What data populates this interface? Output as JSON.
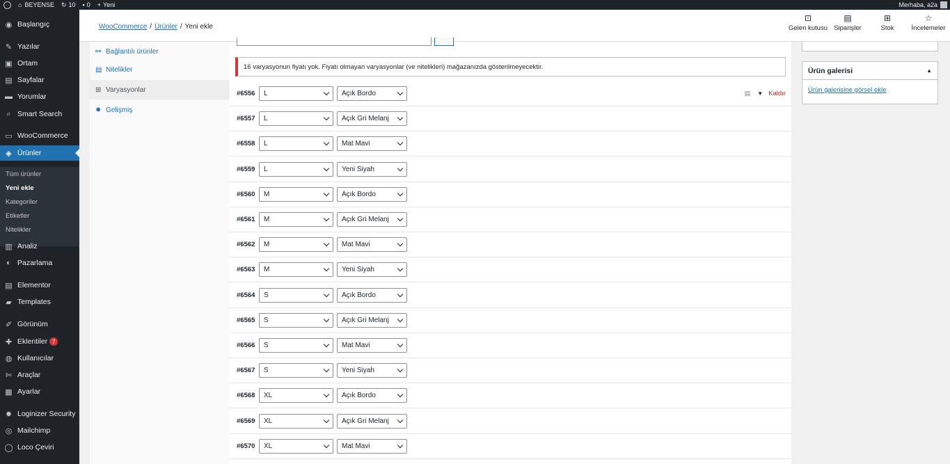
{
  "admin_bar": {
    "site_name": "BEYENSE",
    "updates": "10",
    "comments": "0",
    "new_label": "Yeni",
    "greeting": "Merhaba, a2a"
  },
  "sidebar": {
    "items": [
      {
        "label": "Başlangıç",
        "icon": "dashboard-icon",
        "glyph": "◉"
      },
      {
        "label": "Yazılar",
        "icon": "pin-icon",
        "glyph": "✎"
      },
      {
        "label": "Ortam",
        "icon": "media-icon",
        "glyph": "▣"
      },
      {
        "label": "Sayfalar",
        "icon": "pages-icon",
        "glyph": "▤"
      },
      {
        "label": "Yorumlar",
        "icon": "comments-icon",
        "glyph": "▬"
      },
      {
        "label": "Smart Search",
        "icon": "search-icon",
        "glyph": "⌕"
      },
      {
        "label": "WooCommerce",
        "icon": "woo-icon",
        "glyph": "▭"
      },
      {
        "label": "Ürünler",
        "icon": "products-icon",
        "glyph": "◈"
      },
      {
        "label": "Analiz",
        "icon": "analytics-icon",
        "glyph": "▥"
      },
      {
        "label": "Pazarlama",
        "icon": "marketing-icon",
        "glyph": "◐"
      },
      {
        "label": "Elementor",
        "icon": "elementor-icon",
        "glyph": "▤"
      },
      {
        "label": "Templates",
        "icon": "templates-icon",
        "glyph": "▰"
      },
      {
        "label": "Görünüm",
        "icon": "appearance-icon",
        "glyph": "✐"
      },
      {
        "label": "Eklentiler",
        "icon": "plugins-icon",
        "glyph": "✚",
        "badge": "7"
      },
      {
        "label": "Kullanıcılar",
        "icon": "users-icon",
        "glyph": "◍"
      },
      {
        "label": "Araçlar",
        "icon": "tools-icon",
        "glyph": "✄"
      },
      {
        "label": "Ayarlar",
        "icon": "settings-icon",
        "glyph": "▦"
      },
      {
        "label": "Loginizer Security",
        "icon": "gear-icon",
        "glyph": "✹"
      },
      {
        "label": "Mailchimp",
        "icon": "mailchimp-icon",
        "glyph": "◎"
      },
      {
        "label": "Loco Çeviri",
        "icon": "translate-icon",
        "glyph": "◯"
      }
    ],
    "submenu": [
      "Tüm ürünler",
      "Yeni ekle",
      "Kategoriler",
      "Etiketler",
      "Nitelikler"
    ]
  },
  "header": {
    "breadcrumb": [
      "WooCommerce",
      "Ürünler",
      "Yeni ekle"
    ],
    "buttons": [
      {
        "label": "Gelen kutusu",
        "icon": "inbox-icon",
        "glyph": "⊡"
      },
      {
        "label": "Siparişler",
        "icon": "orders-icon",
        "glyph": "▤"
      },
      {
        "label": "Stok",
        "icon": "stock-icon",
        "glyph": "⊞"
      },
      {
        "label": "İncelemeler",
        "icon": "star-icon",
        "glyph": "☆"
      }
    ]
  },
  "product_tabs": [
    {
      "label": "Bağlantılı ürünler",
      "icon": "link-icon",
      "glyph": "⚯"
    },
    {
      "label": "Nitelikler",
      "icon": "attributes-icon",
      "glyph": "▤"
    },
    {
      "label": "Varyasyonlar",
      "icon": "variations-icon",
      "glyph": "⊞"
    },
    {
      "label": "Gelişmiş",
      "icon": "advanced-gear-icon",
      "glyph": "✹"
    }
  ],
  "notice": "16 varyasyonun fiyatı yok. Fiyatı olmayan varyasyonlar (ve nitelikleri) mağazanızda gösterilmeyecektir.",
  "remove_label": "Kaldır",
  "variations": [
    {
      "id": "#6556",
      "size": "L",
      "color": "Açık Bordo"
    },
    {
      "id": "#6557",
      "size": "L",
      "color": "Açık Gri Melanj"
    },
    {
      "id": "#6558",
      "size": "L",
      "color": "Mat Mavi"
    },
    {
      "id": "#6559",
      "size": "L",
      "color": "Yeni Siyah"
    },
    {
      "id": "#6560",
      "size": "M",
      "color": "Açık Bordo"
    },
    {
      "id": "#6561",
      "size": "M",
      "color": "Açık Gri Melanj"
    },
    {
      "id": "#6562",
      "size": "M",
      "color": "Mat Mavi"
    },
    {
      "id": "#6563",
      "size": "M",
      "color": "Yeni Siyah"
    },
    {
      "id": "#6564",
      "size": "S",
      "color": "Açık Bordo"
    },
    {
      "id": "#6565",
      "size": "S",
      "color": "Açık Gri Melanj"
    },
    {
      "id": "#6566",
      "size": "S",
      "color": "Mat Mavi"
    },
    {
      "id": "#6567",
      "size": "S",
      "color": "Yeni Siyah"
    },
    {
      "id": "#6568",
      "size": "XL",
      "color": "Açık Bordo"
    },
    {
      "id": "#6569",
      "size": "XL",
      "color": "Açık Gri Melanj"
    },
    {
      "id": "#6570",
      "size": "XL",
      "color": "Mat Mavi"
    }
  ],
  "gallery": {
    "title": "Ürün galerisi",
    "link": "Ürün galerisine görsel ekle"
  }
}
